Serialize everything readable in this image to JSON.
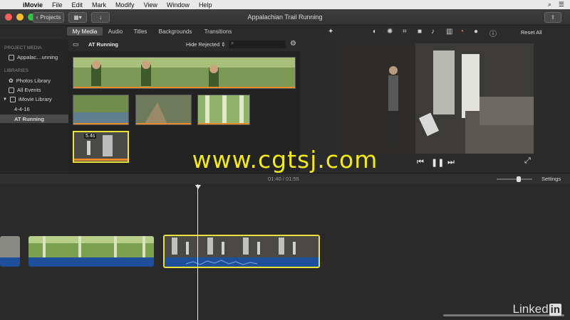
{
  "menubar": {
    "app_name": "iMovie",
    "items": [
      "File",
      "Edit",
      "Mark",
      "Modify",
      "View",
      "Window",
      "Help"
    ]
  },
  "toolbar": {
    "back_label": "Projects",
    "window_title": "Appalachian Trail Running"
  },
  "browser": {
    "tabs": [
      "My Media",
      "Audio",
      "Titles",
      "Backgrounds",
      "Transitions"
    ],
    "active_tab": "My Media",
    "event_name": "AT Running",
    "filter_label": "Hide Rejected",
    "selected_clip_duration": "5.4s"
  },
  "sidebar": {
    "project_media_heading": "PROJECT MEDIA",
    "project_item": "Appalac…unning",
    "libraries_heading": "LIBRARIES",
    "items": [
      "Photos Library",
      "All Events",
      "iMovie Library",
      "4-4-16",
      "AT Running"
    ]
  },
  "viewer": {
    "reset_label": "Reset All"
  },
  "timeline": {
    "timecode": "01:40 / 01:55",
    "settings_label": "Settings"
  },
  "watermark": "www.cgtsj.com",
  "brand": {
    "linked": "Linked",
    "in": "in"
  },
  "colors": {
    "selection_yellow": "#e9e23a",
    "audio_blue": "#1f4f9a",
    "watermark_yellow": "#f2ea12"
  }
}
